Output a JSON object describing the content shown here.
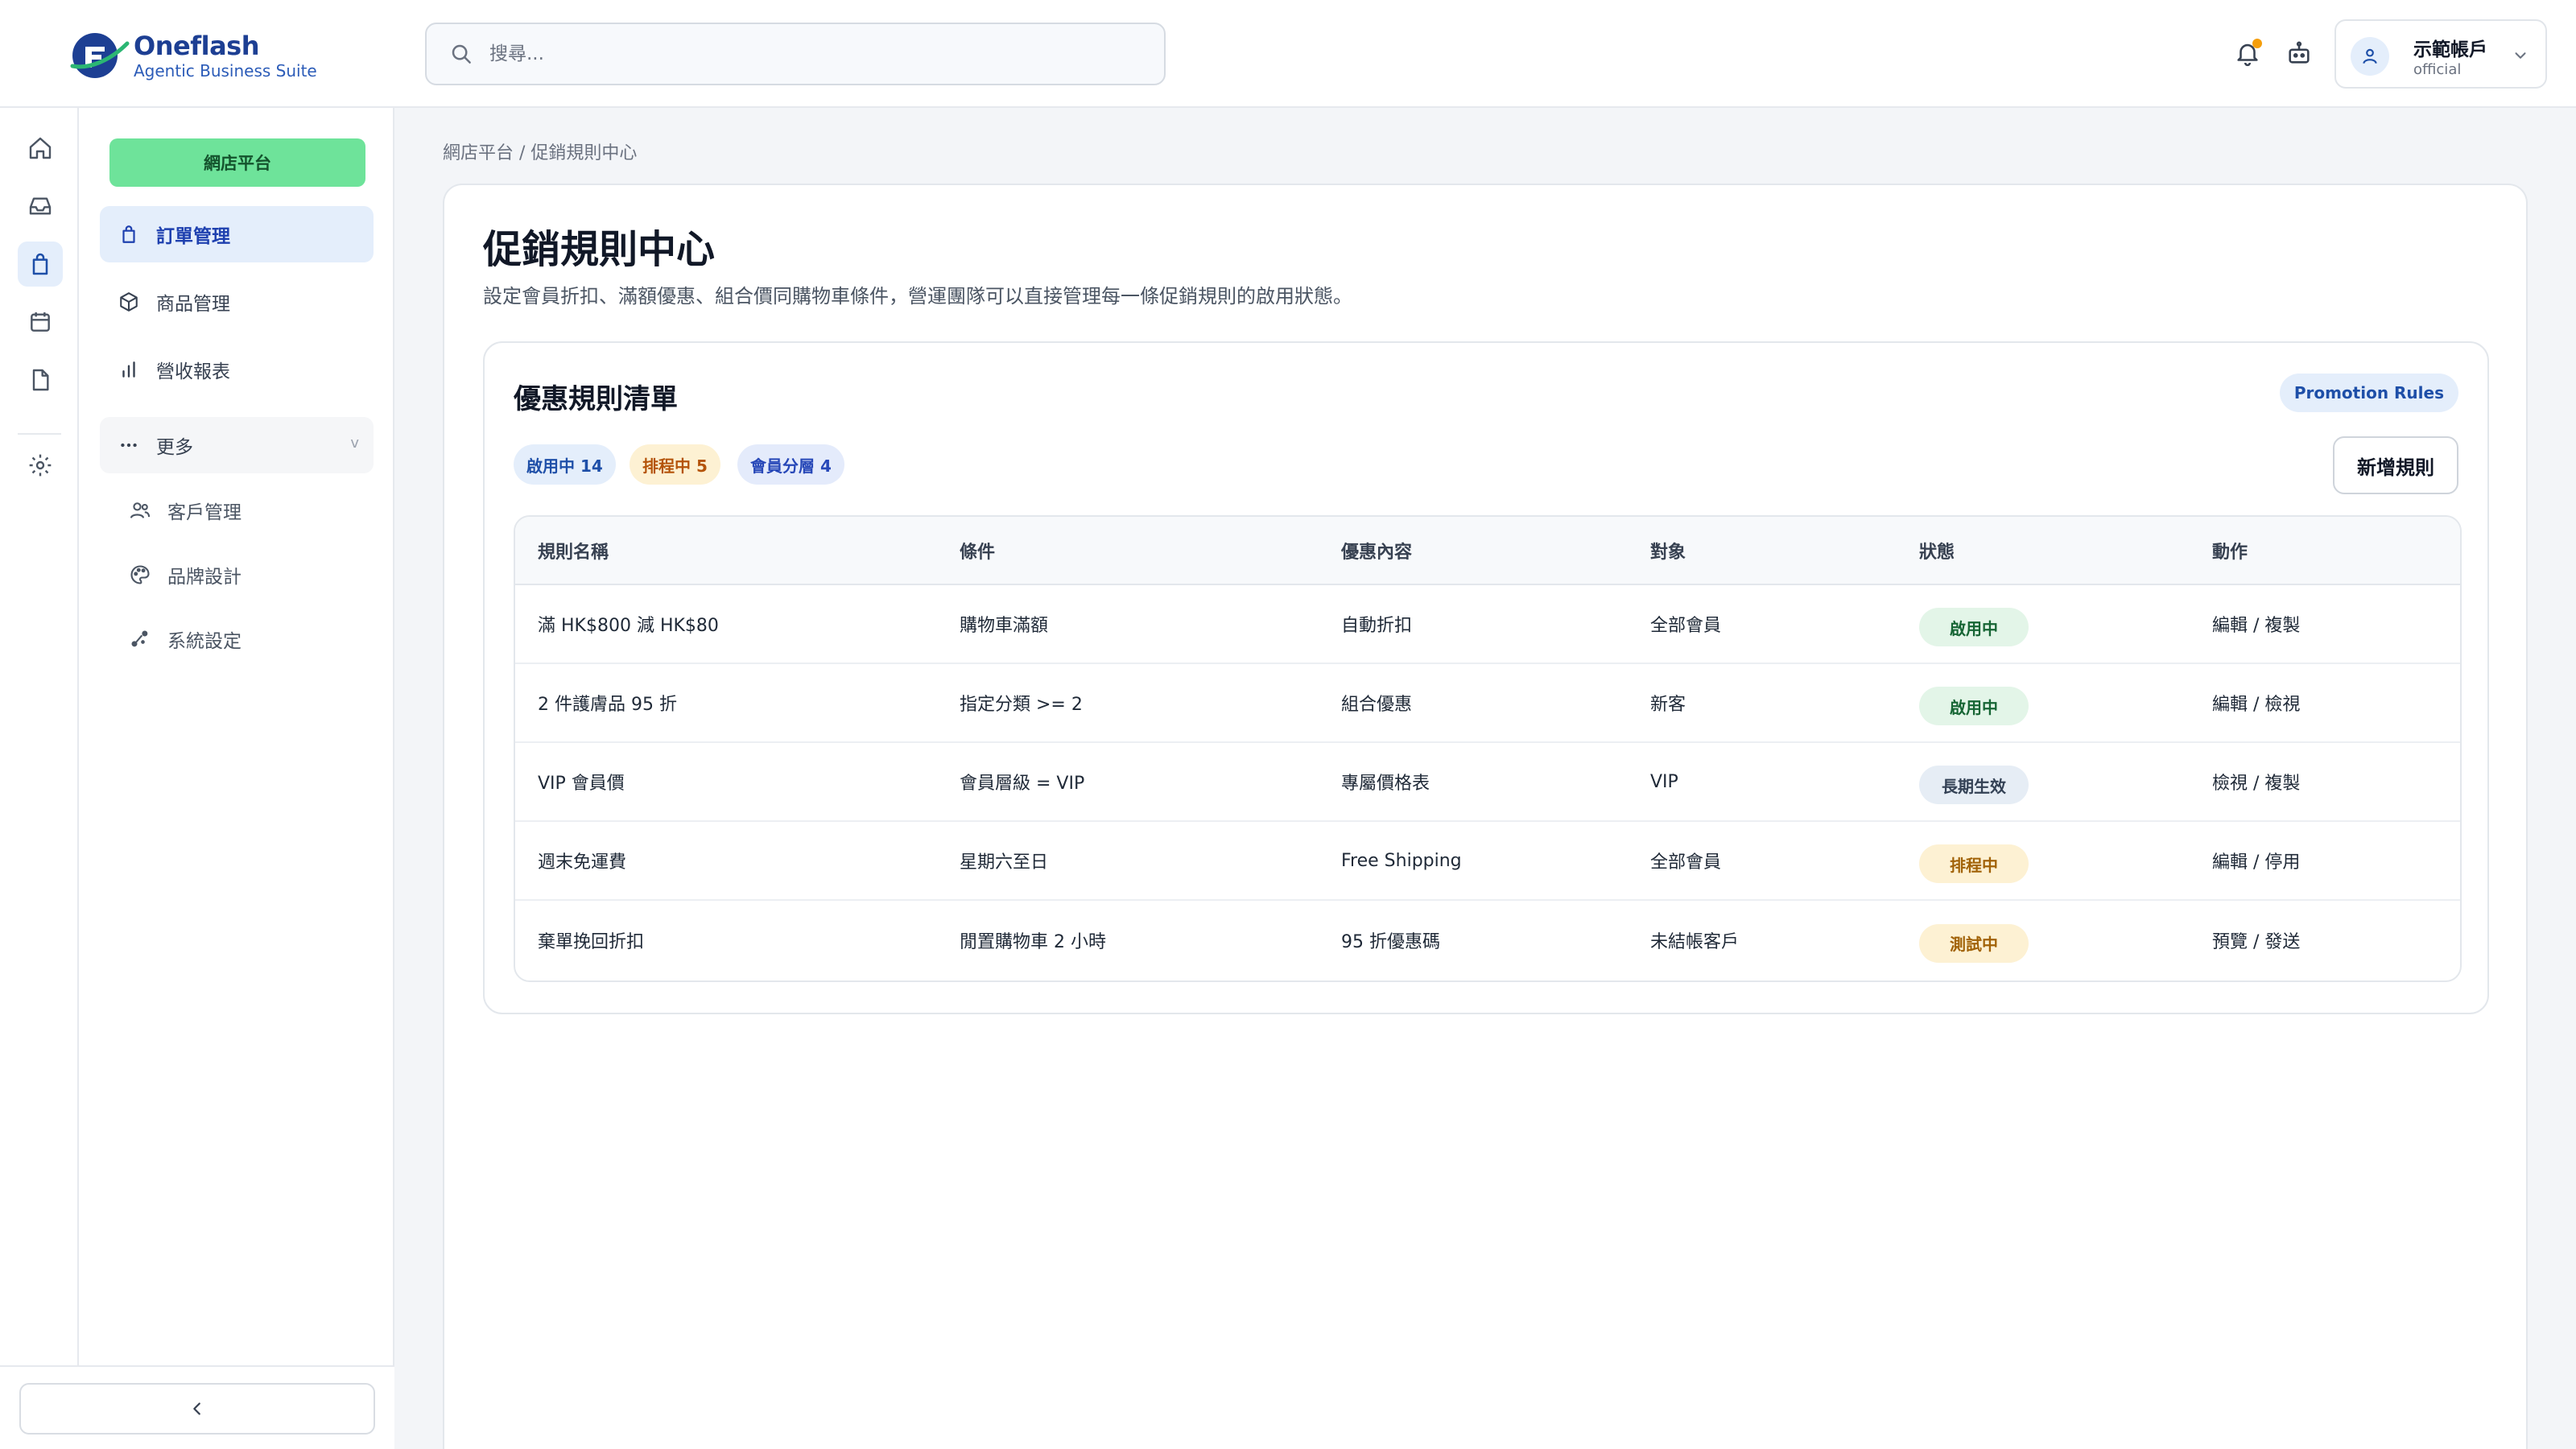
{
  "brand": {
    "name": "Oneflash",
    "tagline": "Agentic Business Suite",
    "color": "#1d3f93"
  },
  "rail": {
    "icons": [
      "home-icon",
      "inbox-icon",
      "shopping-bag-icon",
      "calendar-icon",
      "file-icon",
      "gear-icon"
    ],
    "active": "shopping-bag-icon"
  },
  "sidebar": {
    "platform_label": "網店平台",
    "items": [
      {
        "label": "訂單管理",
        "icon": "shopping-bag-icon",
        "active": true
      },
      {
        "label": "商品管理",
        "icon": "box-icon"
      },
      {
        "label": "營收報表",
        "icon": "bar-chart-icon"
      }
    ],
    "more": {
      "label": "更多",
      "icon": "more-dots-icon",
      "chevron": "v"
    },
    "sub_items": [
      {
        "label": "客戶管理",
        "icon": "users-icon"
      },
      {
        "label": "品牌設計",
        "icon": "palette-icon"
      },
      {
        "label": "系統設定",
        "icon": "settings-share-icon"
      }
    ],
    "collapse_icon": "chevron-left-icon"
  },
  "topbar": {
    "search_placeholder": "搜尋...",
    "account": {
      "name": "示範帳戶",
      "role": "official"
    }
  },
  "main": {
    "breadcrumb": "網店平台 / 促銷規則中心",
    "title": "促銷規則中心",
    "description": "設定會員折扣、滿額優惠、組合價同購物車條件，營運團隊可以直接管理每一條促銷規則的啟用狀態。",
    "rules": {
      "title": "優惠規則清單",
      "tag": "Promotion Rules",
      "pills": [
        "啟用中 14",
        "排程中 5",
        "會員分層 4"
      ],
      "add_button": "新增規則",
      "columns": [
        "規則名稱",
        "條件",
        "優惠內容",
        "對象",
        "狀態",
        "動作"
      ],
      "rows": [
        {
          "name": "滿 HK$800 減 HK$80",
          "condition": "購物車滿額",
          "benefit": "自動折扣",
          "target": "全部會員",
          "status": "啟用中",
          "status_color": "green",
          "action": "編輯 / 複製"
        },
        {
          "name": "2 件護膚品 95 折",
          "condition": "指定分類 >= 2",
          "benefit": "組合優惠",
          "target": "新客",
          "status": "啟用中",
          "status_color": "green",
          "action": "編輯 / 檢視"
        },
        {
          "name": "VIP 會員價",
          "condition": "會員層級 = VIP",
          "benefit": "專屬價格表",
          "target": "VIP",
          "status": "長期生效",
          "status_color": "slate",
          "action": "檢視 / 複製"
        },
        {
          "name": "週末免運費",
          "condition": "星期六至日",
          "benefit": "Free Shipping",
          "target": "全部會員",
          "status": "排程中",
          "status_color": "amber",
          "action": "編輯 / 停用"
        },
        {
          "name": "棄單挽回折扣",
          "condition": "閒置購物車 2 小時",
          "benefit": "95 折優惠碼",
          "target": "未結帳客戶",
          "status": "測試中",
          "status_color": "amber",
          "action": "預覽 / 發送"
        }
      ]
    }
  },
  "colors": {
    "accent_green": "#6ee39a",
    "accent_blue": "#1e4fa8",
    "amber": "#f59e0b"
  }
}
